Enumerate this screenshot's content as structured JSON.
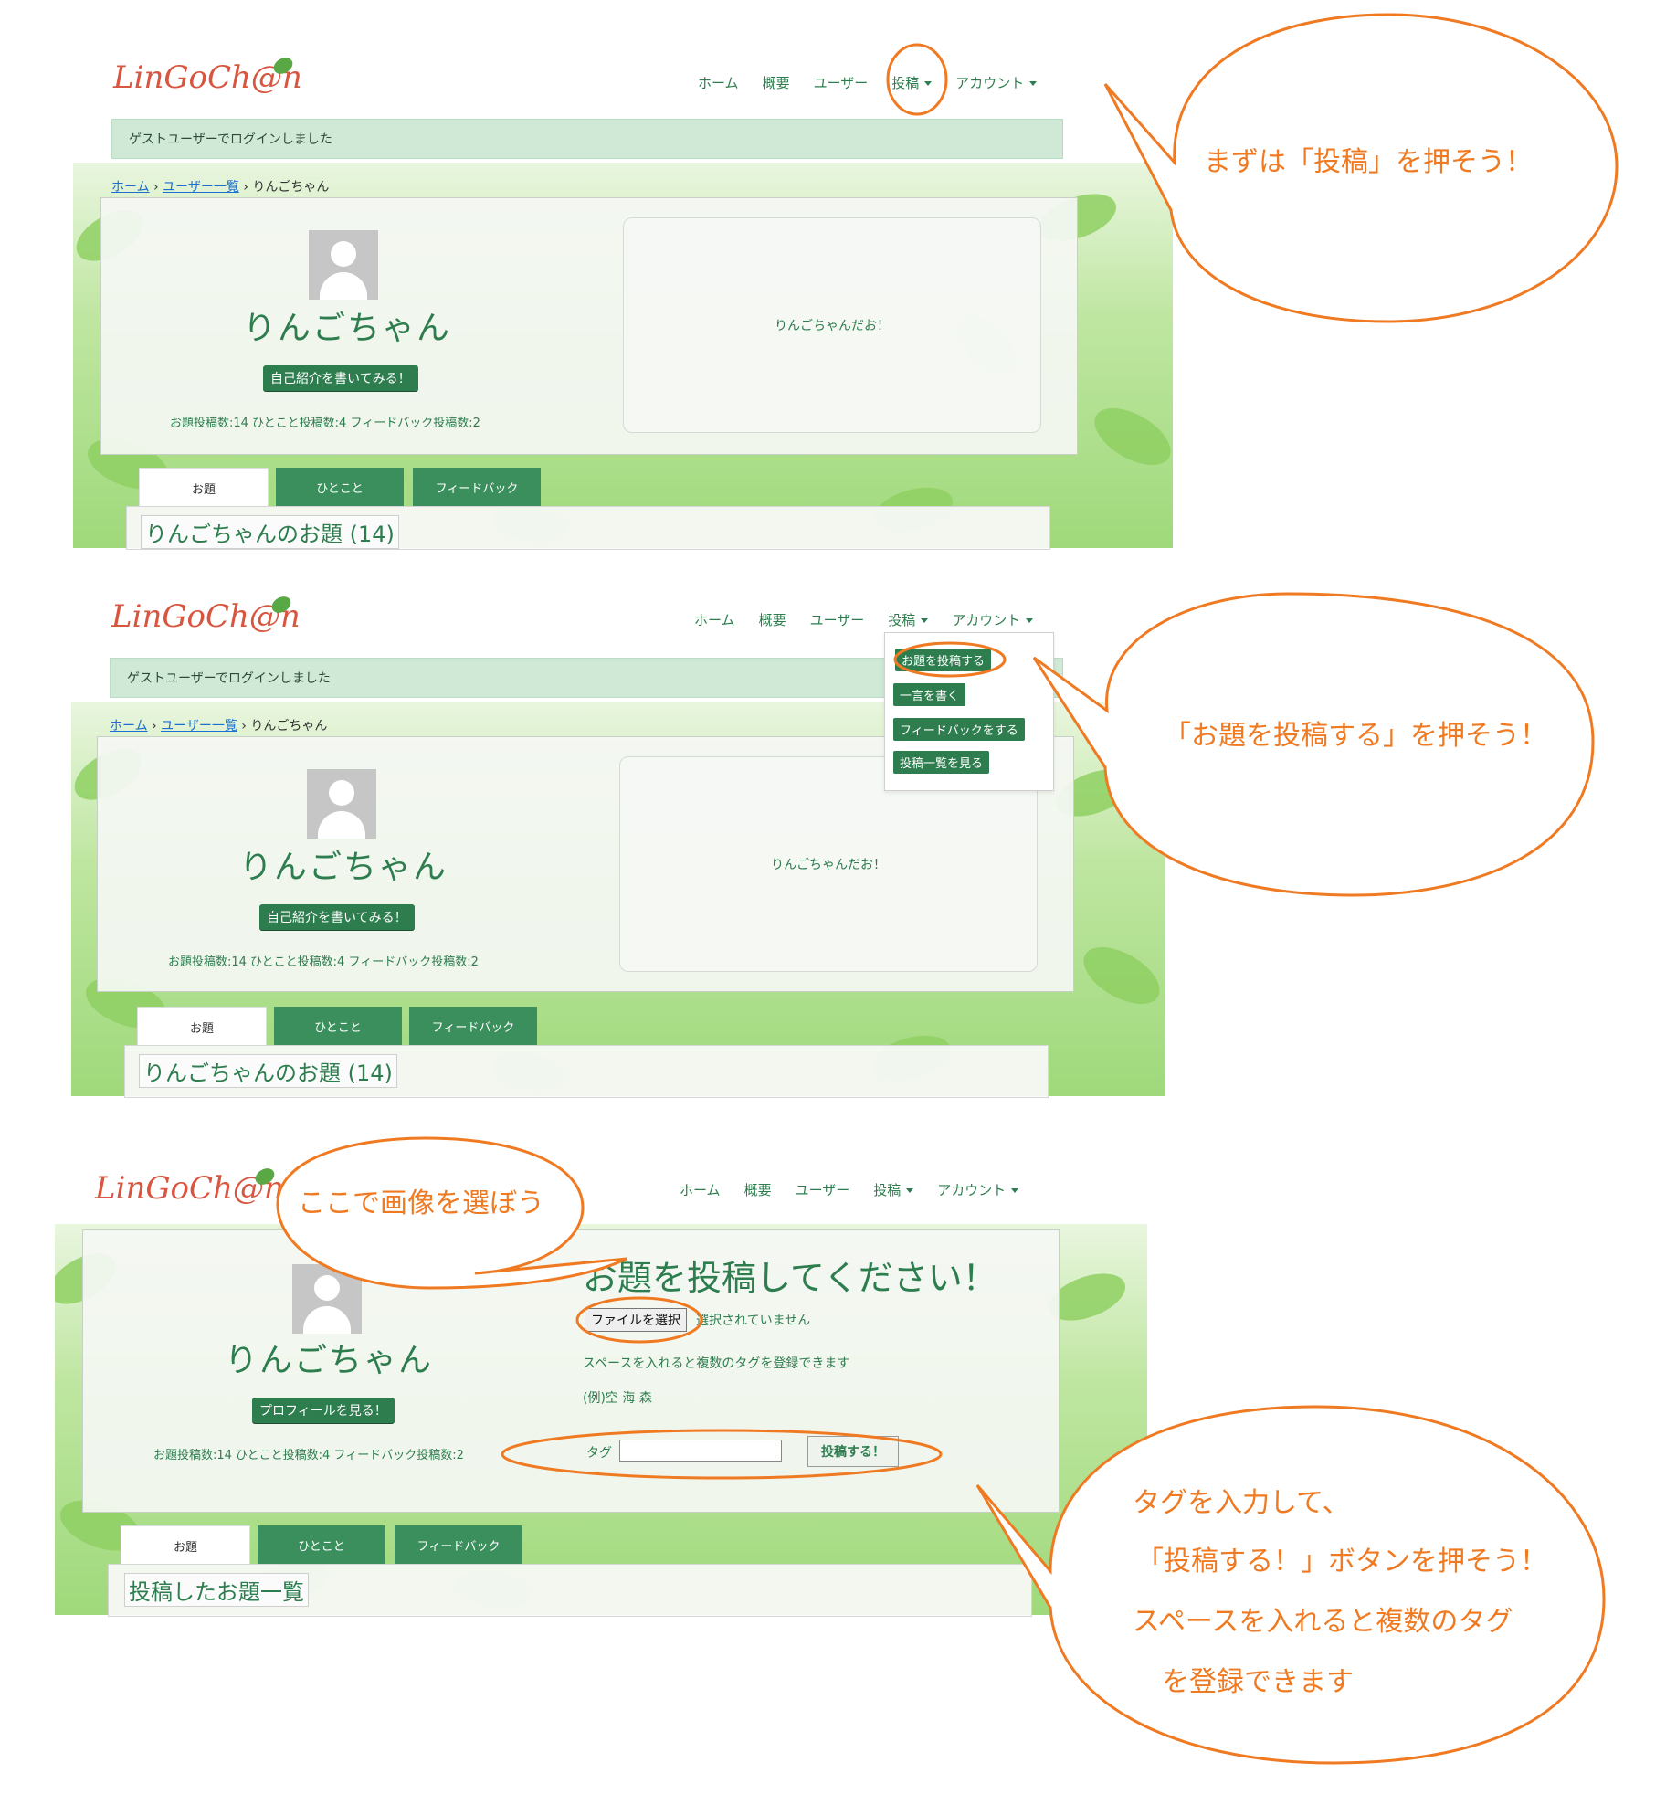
{
  "logo_text": "LinGoCh@n",
  "nav": {
    "home": "ホーム",
    "about": "概要",
    "users": "ユーザー",
    "post": "投稿",
    "account": "アカウント"
  },
  "flash": "ゲストユーザーでログインしました",
  "breadcrumb": {
    "home": "ホーム",
    "users_list": "ユーザー一覧",
    "current": "りんごちゃん"
  },
  "profile": {
    "name": "りんごちゃん",
    "intro_button": "自己紹介を書いてみる！",
    "profile_button": "プロフィールを見る！",
    "stats": "お題投稿数:14 ひとこと投稿数:4 フィードバック投稿数:2",
    "bio": "りんごちゃんだお！"
  },
  "tabs": [
    "お題",
    "ひとこと",
    "フィードバック"
  ],
  "list_title": "りんごちゃんのお題 (14)",
  "posted_list_title": "投稿したお題一覧",
  "post_menu": [
    "お題を投稿する",
    "一言を書く",
    "フィードバックをする",
    "投稿一覧を見る"
  ],
  "post_form": {
    "title": "お題を投稿してください！",
    "file_button": "ファイルを選択",
    "file_status": "選択されていません",
    "hint": "スペースを入れると複数のタグを登録できます",
    "example": "(例)空 海 森",
    "tag_label": "タグ",
    "submit": "投稿する！"
  },
  "annotations": {
    "step1": "まずは「投稿」を押そう！",
    "step2": "「お題を投稿する」を押そう！",
    "step3": "ここで画像を選ぼう",
    "step4": [
      "タグを入力して、",
      "「投稿する！」ボタンを押そう！",
      "スペースを入れると複数のタグ",
      "を登録できます"
    ]
  },
  "colors": {
    "brand_green": "#2e7d4f",
    "annotation_orange": "#ef7a22",
    "flash_bg": "#cfe9d6"
  }
}
